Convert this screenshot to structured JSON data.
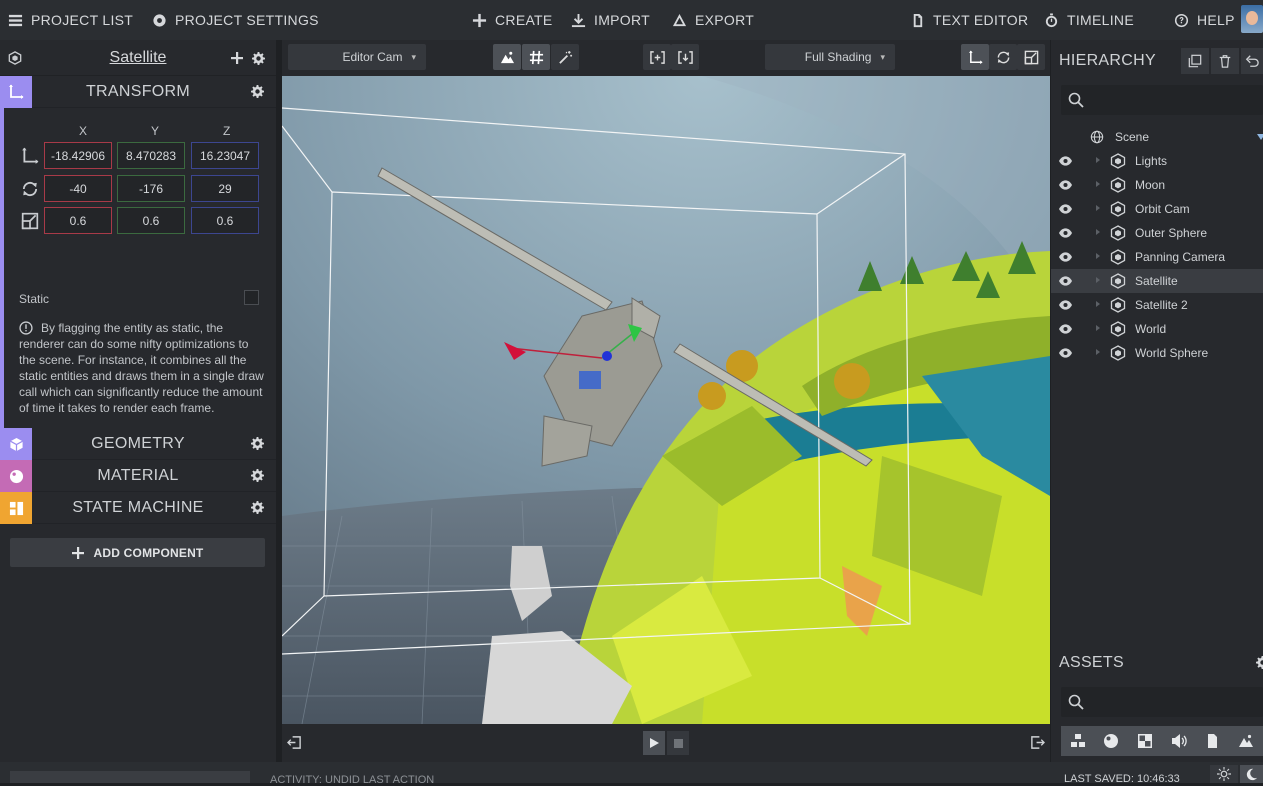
{
  "topbar": {
    "project_list": "PROJECT LIST",
    "project_settings": "PROJECT SETTINGS",
    "create": "CREATE",
    "import": "IMPORT",
    "export": "EXPORT",
    "text_editor": "TEXT EDITOR",
    "timeline": "TIMELINE",
    "help": "HELP"
  },
  "inspector": {
    "entity_name": "Satellite",
    "transform": {
      "title": "TRANSFORM",
      "axes": [
        "X",
        "Y",
        "Z"
      ],
      "position": [
        "-18.42906",
        "8.470283",
        "16.23047"
      ],
      "rotation": [
        "-40",
        "-176",
        "29"
      ],
      "scale": [
        "0.6",
        "0.6",
        "0.6"
      ],
      "static_label": "Static",
      "static_checked": false,
      "info": "By flagging the entity as static, the renderer can do some nifty optimizations to the scene. For instance, it combines all the static entities and draws them in a single draw call which can significantly reduce the amount of time it takes to render each frame."
    },
    "components": [
      {
        "title": "GEOMETRY",
        "color": "#9b8df0"
      },
      {
        "title": "MATERIAL",
        "color": "#c46bb5"
      },
      {
        "title": "STATE MACHINE",
        "color": "#f0a531"
      }
    ],
    "add_component": "ADD COMPONENT"
  },
  "viewport": {
    "camera": "Editor Cam",
    "shading": "Full Shading"
  },
  "hierarchy": {
    "title": "HIERARCHY",
    "root": "Scene",
    "items": [
      {
        "label": "Lights",
        "selected": false
      },
      {
        "label": "Moon",
        "selected": false
      },
      {
        "label": "Orbit Cam",
        "selected": false
      },
      {
        "label": "Outer Sphere",
        "selected": false
      },
      {
        "label": "Panning Camera",
        "selected": false
      },
      {
        "label": "Satellite",
        "selected": true
      },
      {
        "label": "Satellite 2",
        "selected": false
      },
      {
        "label": "World",
        "selected": false
      },
      {
        "label": "World Sphere",
        "selected": false
      }
    ]
  },
  "assets": {
    "title": "ASSETS"
  },
  "statusbar": {
    "activity": "ACTIVITY: UNDID LAST ACTION",
    "last_saved": "LAST SAVED: 10:46:33"
  }
}
